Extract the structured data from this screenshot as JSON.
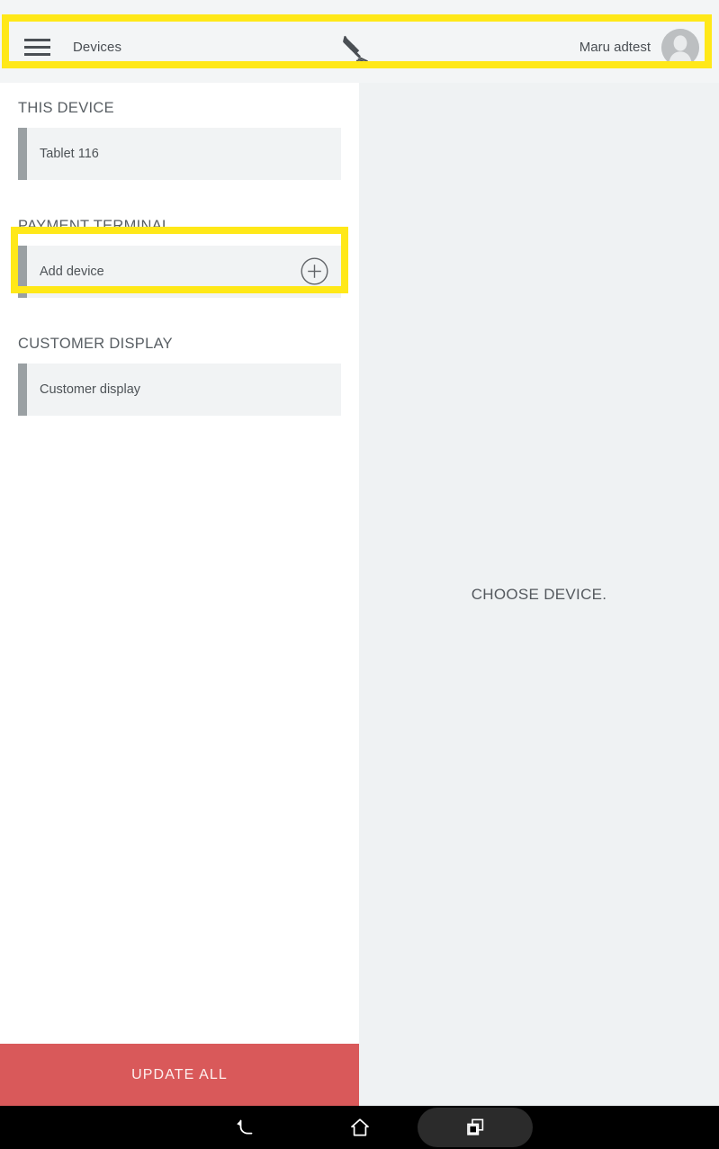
{
  "topbar": {
    "menu_icon": "hamburger-menu-icon",
    "title": "Devices",
    "brand_icon": "knife-and-fork-icon",
    "account_name": "Maru adtest",
    "avatar_icon": "user-avatar-icon",
    "highlight_color": "#ffe818",
    "background": "#f3f5f6"
  },
  "sidebar": {
    "sections": [
      {
        "label": "THIS DEVICE",
        "rows": [
          {
            "label": "Tablet 116",
            "has_add_icon": false,
            "highlighted": true
          }
        ]
      },
      {
        "label": "PAYMENT TERMINAL",
        "rows": [
          {
            "label": "Add device",
            "has_add_icon": true,
            "add_icon": "plus-circle-icon",
            "highlighted": false
          }
        ]
      },
      {
        "label": "CUSTOMER DISPLAY",
        "rows": [
          {
            "label": "Customer display",
            "has_add_icon": false,
            "highlighted": false
          }
        ]
      }
    ],
    "row_background": "#f1f3f4",
    "accent_bar_color": "#9aa0a3"
  },
  "footer": {
    "update_all_label": "UPDATE ALL",
    "update_all_color": "#d9595a"
  },
  "main": {
    "empty_state_text": "CHOOSE DEVICE.",
    "background": "#eff2f3"
  },
  "navbar": {
    "back_icon": "back-arrow-icon",
    "home_icon": "home-icon",
    "recent_icon": "recent-apps-icon",
    "background": "#000000",
    "active_pill_color": "#2b2b2b"
  }
}
